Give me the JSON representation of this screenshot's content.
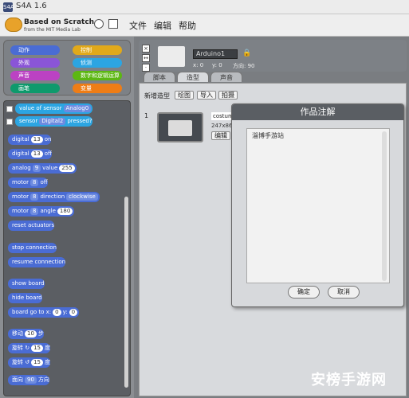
{
  "window": {
    "title": "S4A 1.6",
    "app_icon": "S4A"
  },
  "menubar": {
    "logo_line1": "Based on Scratch",
    "logo_line2": "from the MIT Media Lab",
    "items": [
      "文件",
      "编辑",
      "帮助"
    ]
  },
  "categories": [
    {
      "label": "动作",
      "color": "#4a6cd4"
    },
    {
      "label": "控制",
      "color": "#e1a91a"
    },
    {
      "label": "外观",
      "color": "#8a55d7"
    },
    {
      "label": "侦测",
      "color": "#2ca5e2"
    },
    {
      "label": "声音",
      "color": "#bb42c3"
    },
    {
      "label": "数字和逻辑运算",
      "color": "#5cb712"
    },
    {
      "label": "画笔",
      "color": "#0e9a6c"
    },
    {
      "label": "变量",
      "color": "#ee7d16"
    }
  ],
  "blocks": {
    "b1_text": "value of sensor",
    "b1_dd": "Analog0",
    "b2_text": "sensor",
    "b2_dd": "Digital2",
    "b2_tail": "pressed?",
    "b3_text": "digital",
    "b3_num": "13",
    "b3_tail": "on",
    "b4_text": "digital",
    "b4_num": "13",
    "b4_tail": "off",
    "b5_text": "analog",
    "b5_dd": "9",
    "b5_mid": "value",
    "b5_num": "255",
    "b6_text": "motor",
    "b6_dd": "8",
    "b6_tail": "off",
    "b7_text": "motor",
    "b7_dd": "8",
    "b7_mid": "direction",
    "b7_dd2": "clockwise",
    "b8_text": "motor",
    "b8_dd": "8",
    "b8_mid": "angle",
    "b8_num": "180",
    "b9_text": "reset actuators",
    "b10_text": "stop connection",
    "b11_text": "resume connection",
    "b12_text": "show board",
    "b13_text": "hide board",
    "b14_text": "board go to x:",
    "b14_x": "0",
    "b14_mid": "y:",
    "b14_y": "0",
    "b15_text": "移动",
    "b15_num": "10",
    "b15_tail": "步",
    "b16_text": "旋转 ↻",
    "b16_num": "15",
    "b16_tail": "度",
    "b17_text": "旋转 ↺",
    "b17_num": "15",
    "b17_tail": "度",
    "b18_text": "面向",
    "b18_num": "90",
    "b18_tail": "方向"
  },
  "sprite": {
    "name": "Arduino1",
    "x_label": "x:",
    "x": "0",
    "y_label": "y:",
    "y": "0",
    "dir_label": "方向:",
    "dir": "90"
  },
  "tabs": [
    "脚本",
    "造型",
    "声音"
  ],
  "costumes": {
    "new_label": "新增造型",
    "paint": "绘图",
    "import": "导入",
    "camera": "拍摄",
    "number": "1",
    "name": "costume",
    "size": "247x86",
    "edit": "编辑"
  },
  "dialog": {
    "title": "作品注解",
    "text": "淄博手游站",
    "ok": "确定",
    "cancel": "取消"
  },
  "watermark": "安榜手游网"
}
